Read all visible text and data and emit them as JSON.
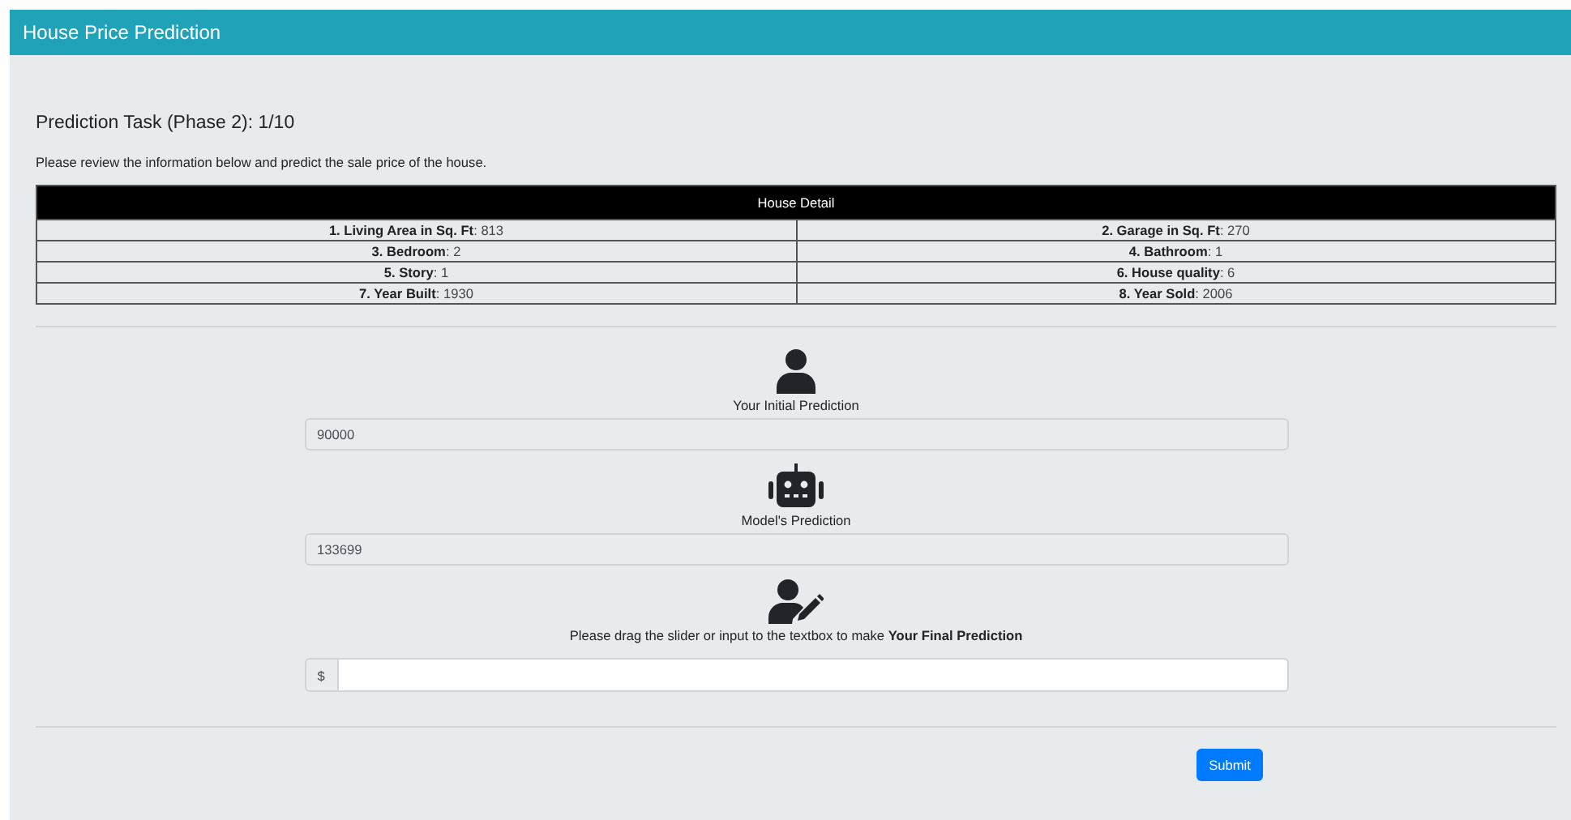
{
  "header": {
    "title": "House Price Prediction"
  },
  "task": {
    "title": "Prediction Task (Phase 2): 1/10",
    "instruction": "Please review the information below and predict the sale price of the house."
  },
  "house_detail": {
    "title": "House Detail",
    "rows": [
      [
        "**1. Living Area in Sq. Ft**: 813",
        "**2. Garage in Sq. Ft**: 270"
      ],
      [
        "**3. Bedroom**: 2",
        "**4. Bathroom**: 1"
      ],
      [
        "**5. Story**: 1",
        "**6. House quality**: 6"
      ],
      [
        "**7. Year Built**: 1930",
        "**8. Year Sold**: 2006"
      ]
    ]
  },
  "predictions": [
    {
      "kind": "person",
      "label": "Your Initial Prediction",
      "value": "90000"
    },
    {
      "kind": "robot",
      "label": "Model's Prediction",
      "value": "133699"
    },
    {
      "kind": "editor",
      "label": "Please drag the slider or input to the textbox to make **Your Final Prediction**",
      "prefix": "$"
    }
  ],
  "submit_button": "Submit"
}
